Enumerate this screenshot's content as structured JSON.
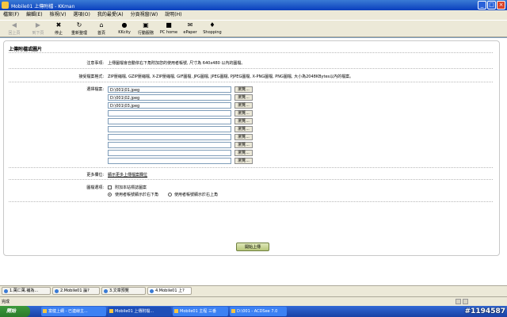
{
  "window": {
    "title": "Mobile01 上傳附檔 - KKman"
  },
  "menu": [
    "檔案(F)",
    "編輯(E)",
    "檢視(V)",
    "選項(O)",
    "我的最愛(A)",
    "分頁視窗(W)",
    "說明(H)"
  ],
  "toolbar": [
    {
      "label": "回上頁",
      "icon": "◀",
      "name": "back",
      "disabled": true
    },
    {
      "label": "到下頁",
      "icon": "▶",
      "name": "forward",
      "disabled": true
    },
    {
      "label": "停止",
      "icon": "✖",
      "name": "stop",
      "disabled": false
    },
    {
      "label": "重新整理",
      "icon": "↻",
      "name": "refresh",
      "disabled": false
    },
    {
      "label": "首頁",
      "icon": "⌂",
      "name": "home",
      "disabled": false
    },
    {
      "label": "KKcity",
      "icon": "●",
      "name": "kkcity",
      "disabled": false
    },
    {
      "label": "行動服務",
      "icon": "▣",
      "name": "mobile-service",
      "disabled": false
    },
    {
      "label": "PC home",
      "icon": "■",
      "name": "pchome",
      "disabled": false
    },
    {
      "label": "ePaper",
      "icon": "✉",
      "name": "epaper",
      "disabled": false
    },
    {
      "label": "Shopping",
      "icon": "♦",
      "name": "shopping",
      "disabled": false
    }
  ],
  "page": {
    "title": "上傳附檔或圖片",
    "notice_label": "注意事項:",
    "notice_text": "上傳圖檔會自動依右下角附加您的使用者帳號, 尺寸為 640x480 以內的圖檔。",
    "formats_label": "接受檔案格式:",
    "formats_text": "ZIP壓縮檔, GZIP壓縮檔, X-ZIP壓縮檔, GIF圖檔, JPG圖檔, JPEG圖檔, PJPEG圖檔, X-PNG圖檔, PNG圖檔, 大小為2048KBytes以內的檔案。",
    "select_label": "選擇檔案:",
    "browse_label": "瀏覽...",
    "files": [
      "D:\\001\\01.jpeg",
      "D:\\001\\02.jpeg",
      "D:\\001\\03.jpeg",
      "",
      "",
      "",
      "",
      "",
      "",
      ""
    ],
    "more_label": "更多欄位:",
    "more_link": "顯示更多上傳檔案欄位",
    "image_options_label": "圖檔選項:",
    "option_no_watermark": "附加本站標誌圖案",
    "option_bottom_right": "使用者帳號顯示於右下角",
    "option_top_right": "使用者帳號顯示於右上角",
    "submit": "開始上傳"
  },
  "tabs": [
    {
      "label": "1.萬ㄈ萬.補為..."
    },
    {
      "label": "2.Mobile01 論?"
    },
    {
      "label": "3.文章預覽"
    },
    {
      "label": "4.Mobile01 上?"
    }
  ],
  "status": {
    "text": "完成"
  },
  "taskbar": {
    "start": "開始",
    "tasks": [
      "富健上網 - 已連線主...",
      "Mobile01 上傳附檔...",
      "Mobile01 主程 三番",
      "D:\\001 - ACDSee 7.0"
    ],
    "watermark": "#1194587"
  }
}
